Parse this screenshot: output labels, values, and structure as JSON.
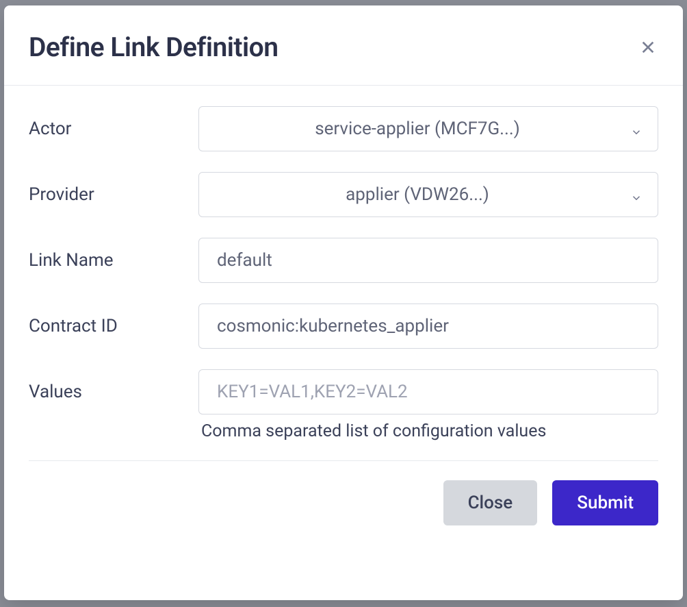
{
  "modal": {
    "title": "Define Link Definition",
    "closeLabel": "Close",
    "submitLabel": "Submit"
  },
  "fields": {
    "actor": {
      "label": "Actor",
      "value": "service-applier (MCF7G...)"
    },
    "provider": {
      "label": "Provider",
      "value": "applier (VDW26...)"
    },
    "linkName": {
      "label": "Link Name",
      "value": "default"
    },
    "contractId": {
      "label": "Contract ID",
      "value": "cosmonic:kubernetes_applier"
    },
    "values": {
      "label": "Values",
      "value": "",
      "placeholder": "KEY1=VAL1,KEY2=VAL2",
      "help": "Comma separated list of configuration values"
    }
  }
}
